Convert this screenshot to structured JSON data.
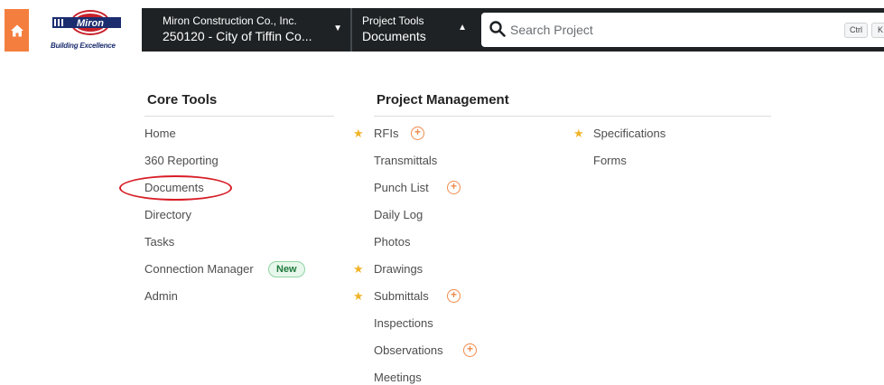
{
  "header": {
    "logo_text": "Miron",
    "logo_tagline": "Building Excellence",
    "company": {
      "name": "Miron Construction Co., Inc.",
      "project": "250120 - City of Tiffin Co..."
    },
    "tools": {
      "label": "Project Tools",
      "selected": "Documents"
    },
    "search": {
      "placeholder": "Search Project",
      "shortcut_ctrl": "Ctrl",
      "shortcut_key": "K"
    }
  },
  "core_tools": {
    "heading": "Core Tools",
    "items": [
      {
        "label": "Home"
      },
      {
        "label": "360 Reporting"
      },
      {
        "label": "Documents"
      },
      {
        "label": "Directory"
      },
      {
        "label": "Tasks"
      },
      {
        "label": "Connection Manager",
        "badge": "New"
      },
      {
        "label": "Admin"
      }
    ]
  },
  "project_management": {
    "heading": "Project Management",
    "column1": [
      {
        "label": "RFIs",
        "starred": true,
        "add": true
      },
      {
        "label": "Transmittals"
      },
      {
        "label": "Punch List",
        "add": true
      },
      {
        "label": "Daily Log"
      },
      {
        "label": "Photos"
      },
      {
        "label": "Drawings",
        "starred": true
      },
      {
        "label": "Submittals",
        "starred": true,
        "add": true
      },
      {
        "label": "Inspections"
      },
      {
        "label": "Observations",
        "add": true
      },
      {
        "label": "Meetings"
      }
    ],
    "column2": [
      {
        "label": "Specifications",
        "starred": true
      },
      {
        "label": "Forms"
      }
    ]
  },
  "colors": {
    "accent_orange": "#f47e3e",
    "header_dark": "#1e2225",
    "star": "#f0b429",
    "highlight_red": "#d81e26",
    "badge_green": "#1f7a3d"
  }
}
